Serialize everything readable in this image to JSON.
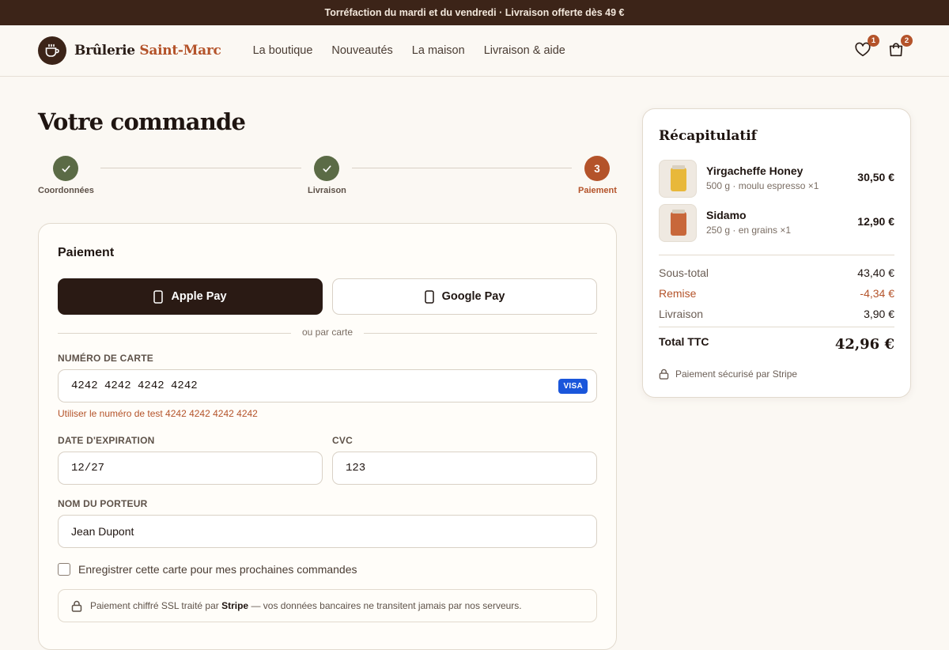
{
  "announcement": "Torréfaction du mardi et du vendredi · Livraison offerte dès 49 €",
  "brand": {
    "name_part1": "Brûlerie",
    "name_part2": "Saint-Marc",
    "logo_icon": "coffee-cup-icon"
  },
  "nav": [
    "La boutique",
    "Nouveautés",
    "La maison",
    "Livraison & aide"
  ],
  "header_icons": {
    "wishlist_count": "1",
    "cart_count": "2"
  },
  "page_title": "Votre commande",
  "steps": [
    {
      "label": "Coordonnées",
      "state": "done"
    },
    {
      "label": "Livraison",
      "state": "done"
    },
    {
      "label": "Paiement",
      "state": "active",
      "number": "3"
    }
  ],
  "payment": {
    "title": "Paiement",
    "apple_pay": "Apple Pay",
    "google_pay": "Google Pay",
    "divider": "ou par carte",
    "card_number_label": "NUMÉRO DE CARTE",
    "card_number_value": "4242 4242 4242 4242",
    "card_brand": "VISA",
    "hint": "Utiliser le numéro de test 4242 4242 4242 4242",
    "expiry_label": "DATE D'EXPIRATION",
    "expiry_value": "12/27",
    "cvc_label": "CVC",
    "cvc_value": "123",
    "holder_label": "NOM DU PORTEUR",
    "holder_value": "Jean Dupont",
    "save_card": "Enregistrer cette carte pour mes prochaines commandes",
    "save_card_checked": false,
    "secure_prefix": "Paiement chiffré SSL traité par",
    "secure_brand": "Stripe",
    "secure_suffix": "— vos données bancaires ne transitent jamais par nos serveurs."
  },
  "summary": {
    "title": "Récapitulatif",
    "items": [
      {
        "name": "Yirgacheffe Honey",
        "desc": "500 g · moulu espresso ×1",
        "price": "30,50 €",
        "bag_color": "#e8b83a"
      },
      {
        "name": "Sidamo",
        "desc": "250 g · en grains ×1",
        "price": "12,90 €",
        "bag_color": "#c8673a"
      }
    ],
    "subtotal_label": "Sous-total",
    "subtotal_value": "43,40 €",
    "discount_label": "Remise",
    "discount_value": "-4,34 €",
    "shipping_label": "Livraison",
    "shipping_value": "3,90 €",
    "total_label": "Total TTC",
    "total_value": "42,96 €",
    "secure_note": "Paiement sécurisé par Stripe"
  },
  "colors": {
    "accent": "#b4532a",
    "dark": "#3c2418",
    "done": "#5b6b46",
    "background": "#fbf8f3"
  }
}
